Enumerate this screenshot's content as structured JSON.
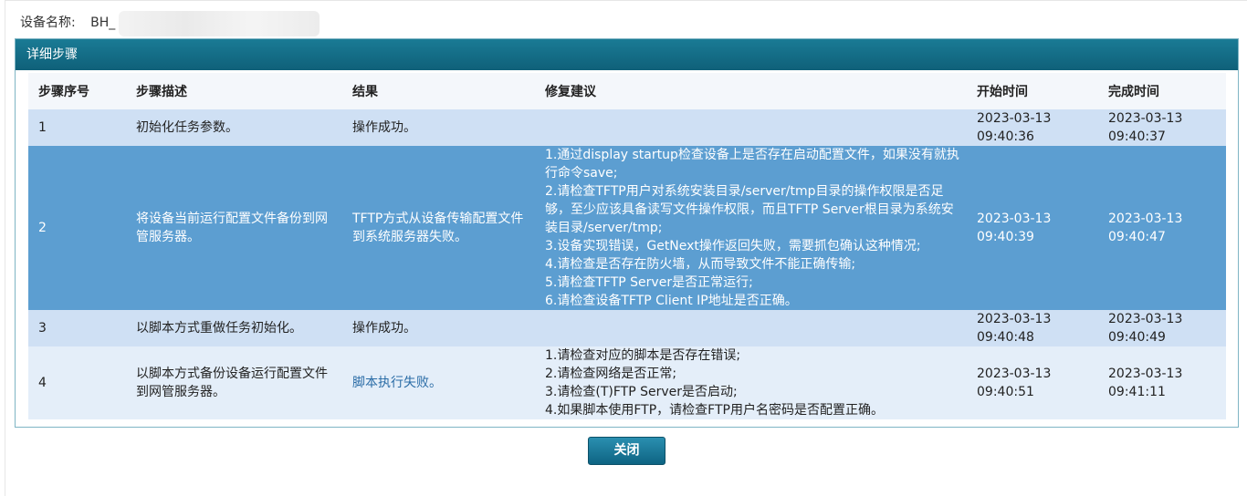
{
  "device": {
    "label": "设备名称:",
    "value": "BH_"
  },
  "panel": {
    "title": "详细步骤"
  },
  "table": {
    "headers": [
      "步骤序号",
      "步骤描述",
      "结果",
      "修复建议",
      "开始时间",
      "完成时间"
    ],
    "rows": [
      {
        "no": "1",
        "desc": "初始化任务参数。",
        "result": "操作成功。",
        "suggestions": [],
        "start_date": "2023-03-13",
        "start_time": "09:40:36",
        "end_date": "2023-03-13",
        "end_time": "09:40:37"
      },
      {
        "no": "2",
        "desc": "将设备当前运行配置文件备份到网管服务器。",
        "result": "TFTP方式从设备传输配置文件到系统服务器失败。",
        "suggestions": [
          "1.通过display startup检查设备上是否存在启动配置文件，如果没有就执行命令save;",
          "2.请检查TFTP用户对系统安装目录/server/tmp目录的操作权限是否足够，至少应该具备读写文件操作权限，而且TFTP Server根目录为系统安装目录/server/tmp;",
          "3.设备实现错误，GetNext操作返回失败，需要抓包确认这种情况;",
          "4.请检查是否存在防火墙，从而导致文件不能正确传输;",
          "5.请检查TFTP Server是否正常运行;",
          "6.请检查设备TFTP Client IP地址是否正确。"
        ],
        "start_date": "2023-03-13",
        "start_time": "09:40:39",
        "end_date": "2023-03-13",
        "end_time": "09:40:47"
      },
      {
        "no": "3",
        "desc": "以脚本方式重做任务初始化。",
        "result": "操作成功。",
        "suggestions": [],
        "start_date": "2023-03-13",
        "start_time": "09:40:48",
        "end_date": "2023-03-13",
        "end_time": "09:40:49"
      },
      {
        "no": "4",
        "desc": "以脚本方式备份设备运行配置文件到网管服务器。",
        "result": "脚本执行失败。",
        "suggestions": [
          "1.请检查对应的脚本是否存在错误;",
          "2.请检查网络是否正常;",
          "3.请检查(T)FTP Server是否启动;",
          "4.如果脚本使用FTP，请检查FTP用户名密码是否配置正确。"
        ],
        "start_date": "2023-03-13",
        "start_time": "09:40:51",
        "end_date": "2023-03-13",
        "end_time": "09:41:11"
      }
    ]
  },
  "footer": {
    "close_label": "关闭"
  },
  "colors": {
    "header_bar": "#0f6079",
    "row_light": "#cfe0f4",
    "row_selected": "#5c9ed1",
    "row_alt": "#e4eef9",
    "link": "#2a6ca6"
  }
}
